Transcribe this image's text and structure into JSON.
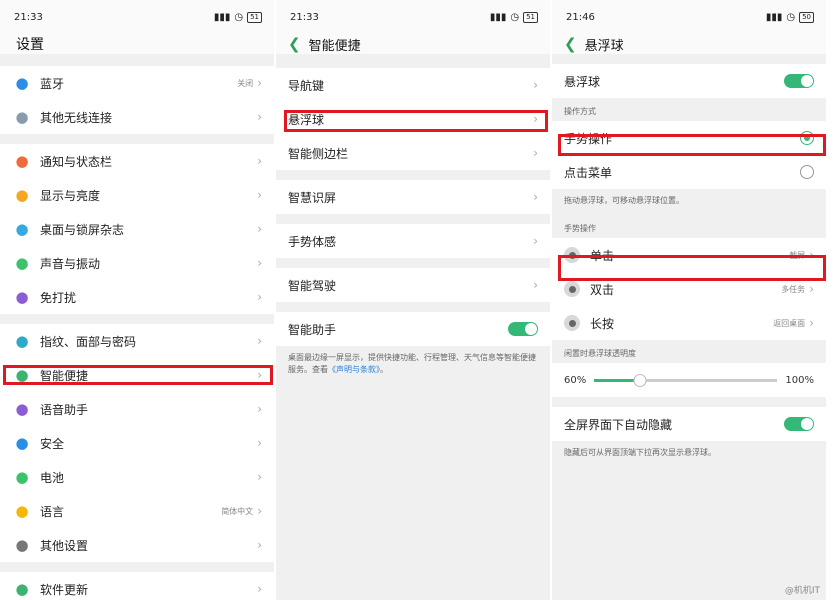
{
  "panel1": {
    "status": {
      "time": "21:33",
      "battery": "51"
    },
    "title": "设置",
    "groups": [
      [
        {
          "label": "蓝牙",
          "value": "关闭",
          "icon": "bluetooth-icon",
          "color": "#2a8ee6"
        },
        {
          "label": "其他无线连接",
          "value": "",
          "icon": "more-dots-icon",
          "color": "#8a9bb0"
        }
      ],
      [
        {
          "label": "通知与状态栏",
          "value": "",
          "icon": "notification-icon",
          "color": "#f06a3c"
        },
        {
          "label": "显示与亮度",
          "value": "",
          "icon": "brightness-icon",
          "color": "#f5a623"
        },
        {
          "label": "桌面与锁屏杂志",
          "value": "",
          "icon": "wallpaper-icon",
          "color": "#36a9e1"
        },
        {
          "label": "声音与振动",
          "value": "",
          "icon": "sound-icon",
          "color": "#3cc26a"
        },
        {
          "label": "免打扰",
          "value": "",
          "icon": "moon-icon",
          "color": "#8b5cd6"
        }
      ],
      [
        {
          "label": "指纹、面部与密码",
          "value": "",
          "icon": "fingerprint-icon",
          "color": "#2ea9c7"
        },
        {
          "label": "智能便捷",
          "value": "",
          "icon": "smart-icon",
          "color": "#3cb371"
        },
        {
          "label": "语音助手",
          "value": "",
          "icon": "voice-icon",
          "color": "#8b5cd6"
        },
        {
          "label": "安全",
          "value": "",
          "icon": "shield-icon",
          "color": "#2a8ee6"
        },
        {
          "label": "电池",
          "value": "",
          "icon": "battery-icon",
          "color": "#3cc26a"
        },
        {
          "label": "语言",
          "value": "简体中文",
          "icon": "language-icon",
          "color": "#f5b700"
        },
        {
          "label": "其他设置",
          "value": "",
          "icon": "gear-icon",
          "color": "#777777"
        }
      ],
      [
        {
          "label": "软件更新",
          "value": "",
          "icon": "update-icon",
          "color": "#3cb371"
        }
      ]
    ]
  },
  "panel2": {
    "status": {
      "time": "21:33",
      "battery": "51"
    },
    "title": "智能便捷",
    "groups": [
      [
        {
          "label": "导航键"
        },
        {
          "label": "悬浮球"
        },
        {
          "label": "智能侧边栏"
        }
      ],
      [
        {
          "label": "智慧识屏"
        }
      ],
      [
        {
          "label": "手势体感"
        }
      ],
      [
        {
          "label": "智能驾驶"
        }
      ]
    ],
    "assistant": {
      "label": "智能助手"
    },
    "note": "桌面最边缘一屏显示，提供快捷功能、行程管理、天气信息等智能便捷服务。查看",
    "note_link": "《声明与条款》",
    "note_end": "。"
  },
  "panel3": {
    "status": {
      "time": "21:46",
      "battery": "50"
    },
    "title": "悬浮球",
    "toggle_label": "悬浮球",
    "mode_section": "操作方式",
    "modes": [
      {
        "label": "手势操作"
      },
      {
        "label": "点击菜单"
      }
    ],
    "mode_note": "拖动悬浮球，可移动悬浮球位置。",
    "gesture_section": "手势操作",
    "gestures": [
      {
        "label": "单击",
        "value": "截屏"
      },
      {
        "label": "双击",
        "value": "多任务"
      },
      {
        "label": "长按",
        "value": "返回桌面"
      }
    ],
    "opacity_section": "闲置时悬浮球透明度",
    "opacity_min": "60%",
    "opacity_max": "100%",
    "opacity_value": 0.25,
    "autohide_label": "全屏界面下自动隐藏",
    "autohide_note": "隐藏后可从界面顶端下拉再次显示悬浮球。"
  },
  "watermark": "@机机IT"
}
